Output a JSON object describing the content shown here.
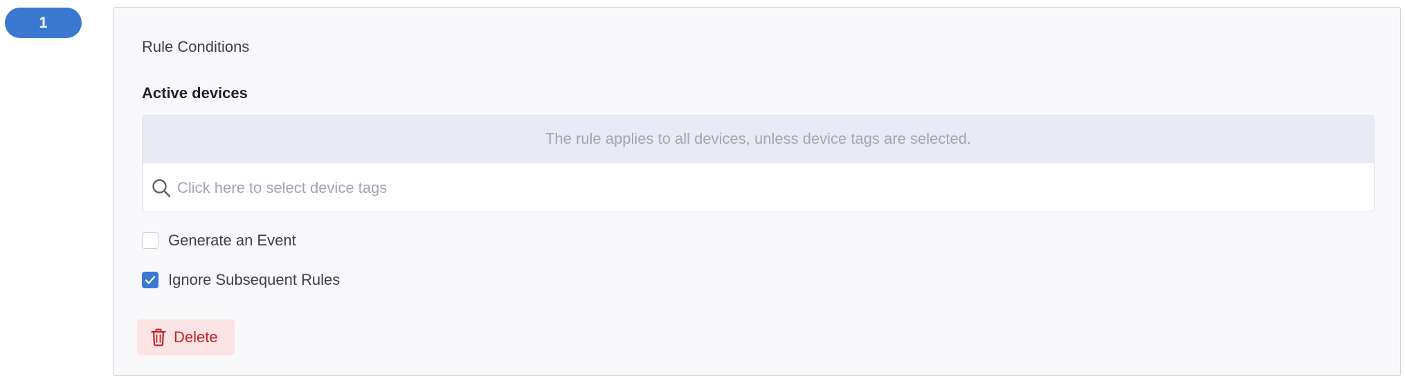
{
  "rule": {
    "number": "1"
  },
  "conditions": {
    "title": "Rule Conditions",
    "active_devices": {
      "label": "Active devices",
      "notice": "The rule applies to all devices, unless device tags are selected.",
      "search": {
        "placeholder": "Click here to select device tags",
        "value": "",
        "icon": "search-icon"
      }
    },
    "options": [
      {
        "label": "Generate an Event",
        "checked": false
      },
      {
        "label": "Ignore Subsequent Rules",
        "checked": true
      }
    ],
    "delete_button": {
      "label": "Delete",
      "icon": "trash-icon"
    }
  },
  "colors": {
    "accent": "#3a78d1",
    "danger_text": "#c4202a",
    "danger_bg": "#fde4e4",
    "notice_bg": "#e8ebf5",
    "card_bg": "#f9f9fb"
  }
}
